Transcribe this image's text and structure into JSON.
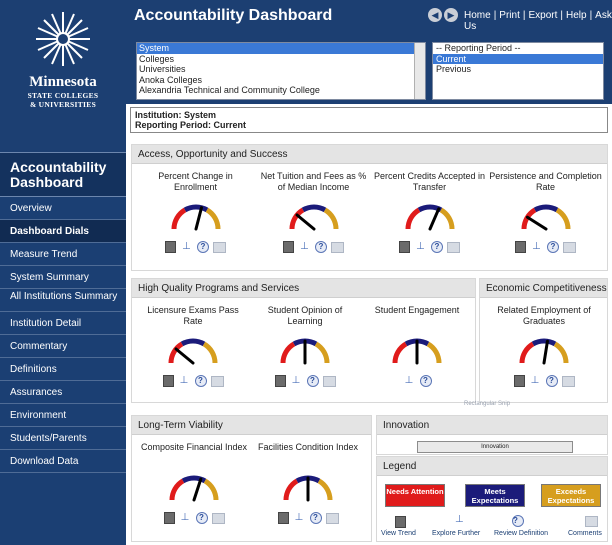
{
  "app": {
    "title": "Accountability Dashboard",
    "links": [
      "Home",
      "Print",
      "Export",
      "Help",
      "Ask Us"
    ],
    "nav_back": "◀",
    "nav_forward": "▶"
  },
  "branding": {
    "name": "Minnesota",
    "sub1": "STATE COLLEGES",
    "sub2": "& UNIVERSITIES",
    "sidebar_title_line1": "Accountability",
    "sidebar_title_line2": "Dashboard"
  },
  "sidebar": {
    "items": [
      {
        "label": "Overview",
        "active": false
      },
      {
        "label": "Dashboard Dials",
        "active": true
      },
      {
        "label": "Measure Trend",
        "active": false
      },
      {
        "label": "System Summary",
        "active": false
      },
      {
        "label": "All Institutions Summary",
        "active": false
      },
      {
        "label": "Institution Detail",
        "active": false
      },
      {
        "label": "Commentary",
        "active": false
      },
      {
        "label": "Definitions",
        "active": false
      },
      {
        "label": "Assurances",
        "active": false
      },
      {
        "label": "Environment",
        "active": false
      },
      {
        "label": "Students/Parents",
        "active": false
      },
      {
        "label": "Download Data",
        "active": false
      }
    ]
  },
  "selectors": {
    "institutions": [
      "System",
      "Colleges",
      "Universities",
      "Anoka Colleges",
      "Alexandria Technical and Community College"
    ],
    "institution_selected": "System",
    "periods": [
      "-- Reporting Period --",
      "Current",
      "Previous"
    ],
    "period_selected": "Current"
  },
  "info": {
    "institution_line": "Institution: System",
    "period_line": "Reporting Period: Current"
  },
  "panels": {
    "access": {
      "title": "Access, Opportunity and Success",
      "dials": [
        {
          "title": "Percent Change in Enrollment",
          "value": 0.58
        },
        {
          "title": "Net Tuition and Fees as % of Median Income",
          "value": 0.22
        },
        {
          "title": "Percent Credits Accepted in Transfer",
          "value": 0.63
        },
        {
          "title": "Persistence and Completion Rate",
          "value": 0.18
        }
      ]
    },
    "quality": {
      "title": "High Quality Programs and Services",
      "dials": [
        {
          "title": "Licensure Exams Pass Rate",
          "value": 0.22
        },
        {
          "title": "Student Opinion of Learning",
          "value": 0.5
        },
        {
          "title": "Student Engagement",
          "value": 0.5
        }
      ]
    },
    "economic": {
      "title": "Economic Competitiveness",
      "dials": [
        {
          "title": "Related Employment of Graduates",
          "value": 0.55
        }
      ]
    },
    "viability": {
      "title": "Long-Term Viability",
      "dials": [
        {
          "title": "Composite Financial Index",
          "value": 0.6
        },
        {
          "title": "Facilities Condition Index",
          "value": 0.5
        }
      ]
    },
    "innovation": {
      "title": "Innovation",
      "button": "Innovation"
    },
    "legend": {
      "title": "Legend",
      "needs": "Needs Attention",
      "meets": "Meets Expectations",
      "exceeds": "Exceeds Expectations",
      "icons": [
        "View Trend",
        "Explore Further",
        "Review Definition",
        "Comments"
      ]
    }
  },
  "tooltip": "Rectangular Snip",
  "colors": {
    "needs": "#e01b1b",
    "meets": "#1b1b7a",
    "exceeds": "#d69e1e",
    "nav_bg": "#1b3f73"
  },
  "icon_names": [
    "view-trend-icon",
    "explore-further-icon",
    "review-definition-icon",
    "comments-icon"
  ]
}
